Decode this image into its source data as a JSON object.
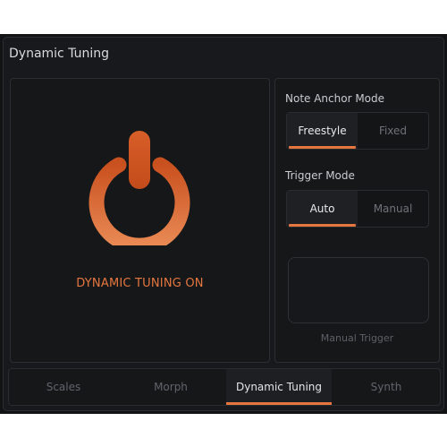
{
  "window": {
    "title": "Dynamic Tuning"
  },
  "hero": {
    "icon": "power-icon",
    "status": "DYNAMIC TUNING ON",
    "accent": "#e5763f"
  },
  "note_anchor": {
    "label": "Note Anchor Mode",
    "options": [
      "Freestyle",
      "Fixed"
    ],
    "selected": "Freestyle"
  },
  "trigger_mode": {
    "label": "Trigger Mode",
    "options": [
      "Auto",
      "Manual"
    ],
    "selected": "Auto"
  },
  "manual_trigger": {
    "label": "Manual Trigger"
  },
  "tabs": {
    "items": [
      "Scales",
      "Morph",
      "Dynamic Tuning",
      "Synth"
    ],
    "selected": "Dynamic Tuning"
  }
}
